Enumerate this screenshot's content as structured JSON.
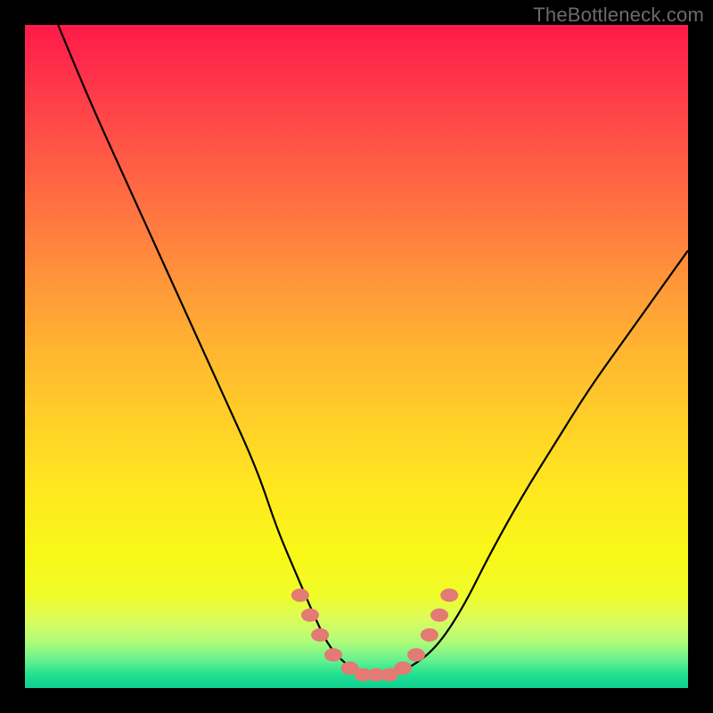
{
  "watermark": "TheBottleneck.com",
  "chart_data": {
    "type": "line",
    "title": "",
    "xlabel": "",
    "ylabel": "",
    "xlim": [
      0,
      100
    ],
    "ylim": [
      0,
      100
    ],
    "grid": false,
    "series": [
      {
        "name": "curve",
        "x": [
          5,
          10,
          15,
          20,
          25,
          30,
          35,
          38,
          41,
          44,
          46,
          49,
          52,
          55,
          58,
          62,
          66,
          70,
          75,
          80,
          85,
          90,
          95,
          100
        ],
        "y": [
          100,
          88,
          77,
          66,
          55,
          44,
          33,
          24,
          17,
          10,
          6,
          3,
          2,
          2,
          3,
          6,
          12,
          20,
          29,
          37,
          45,
          52,
          59,
          66
        ]
      }
    ],
    "markers": {
      "name": "bottleneck-band",
      "points": [
        {
          "x": 41.5,
          "y": 14
        },
        {
          "x": 43.0,
          "y": 11
        },
        {
          "x": 44.5,
          "y": 8
        },
        {
          "x": 46.5,
          "y": 5
        },
        {
          "x": 49.0,
          "y": 3
        },
        {
          "x": 51.0,
          "y": 2
        },
        {
          "x": 53.0,
          "y": 2
        },
        {
          "x": 55.0,
          "y": 2
        },
        {
          "x": 57.0,
          "y": 3
        },
        {
          "x": 59.0,
          "y": 5
        },
        {
          "x": 61.0,
          "y": 8
        },
        {
          "x": 62.5,
          "y": 11
        },
        {
          "x": 64.0,
          "y": 14
        }
      ],
      "style": {
        "color": "#e37a74",
        "radius": 10
      }
    },
    "background_gradient": [
      "#ff1a4a",
      "#ff7a40",
      "#ffe820",
      "#20e090"
    ]
  }
}
